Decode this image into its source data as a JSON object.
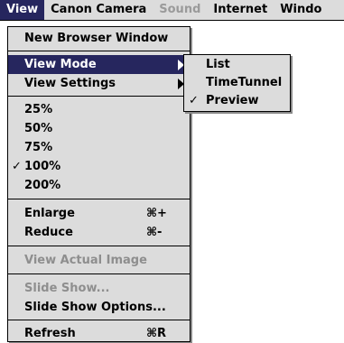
{
  "menubar": {
    "items": [
      {
        "label": "View",
        "active": true,
        "disabled": false
      },
      {
        "label": "Canon Camera",
        "active": false,
        "disabled": false
      },
      {
        "label": "Sound",
        "active": false,
        "disabled": true
      },
      {
        "label": "Internet",
        "active": false,
        "disabled": false
      },
      {
        "label": "Windo",
        "active": false,
        "disabled": false
      }
    ]
  },
  "view_menu": {
    "items": [
      {
        "label": "New Browser Window"
      },
      {
        "label": "View Mode",
        "active": true,
        "submenu": true
      },
      {
        "label": "View Settings",
        "submenu": true
      },
      {
        "label": "25%"
      },
      {
        "label": "50%"
      },
      {
        "label": "75%"
      },
      {
        "label": "100%",
        "checked": true,
        "check": "✓"
      },
      {
        "label": "200%"
      },
      {
        "label": "Enlarge",
        "shortcut": "⌘+"
      },
      {
        "label": "Reduce",
        "shortcut": "⌘-"
      },
      {
        "label": "View Actual Image",
        "disabled": true
      },
      {
        "label": "Slide Show...",
        "disabled": true
      },
      {
        "label": "Slide Show Options..."
      },
      {
        "label": "Refresh",
        "shortcut": "⌘R"
      }
    ]
  },
  "view_mode_submenu": {
    "items": [
      {
        "label": "List"
      },
      {
        "label": "TimeTunnel"
      },
      {
        "label": "Preview",
        "checked": true,
        "check": "✓"
      }
    ]
  }
}
